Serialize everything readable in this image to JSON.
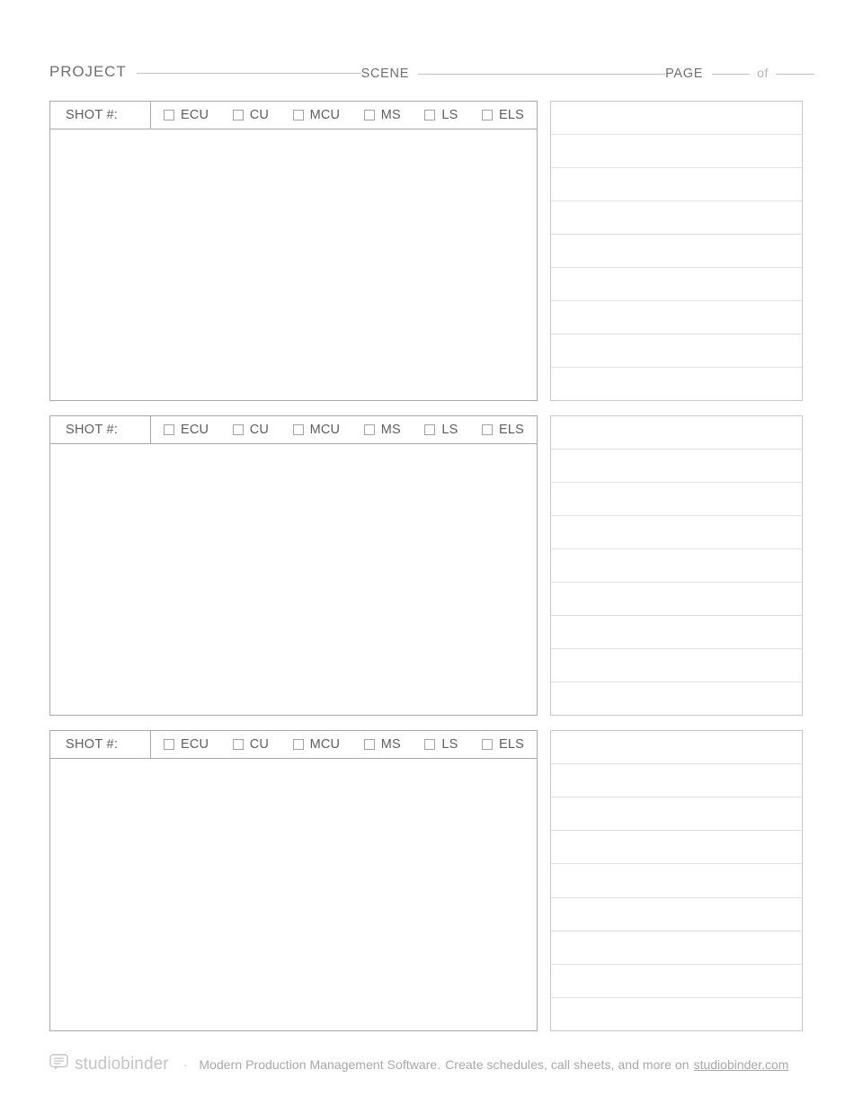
{
  "header": {
    "project_label": "PROJECT",
    "scene_label": "SCENE",
    "page_label": "PAGE",
    "of_label": "of",
    "project_value": "",
    "scene_value": "",
    "page_value": "",
    "page_total_value": ""
  },
  "shot_block": {
    "shot_number_label": "SHOT #:",
    "shot_number_value": "",
    "shot_types": [
      {
        "label": "ECU",
        "checked": false
      },
      {
        "label": "CU",
        "checked": false
      },
      {
        "label": "MCU",
        "checked": false
      },
      {
        "label": "MS",
        "checked": false
      },
      {
        "label": "LS",
        "checked": false
      },
      {
        "label": "ELS",
        "checked": false
      }
    ],
    "notes_line_count": 9,
    "notes_lines": [
      "",
      "",
      "",
      "",
      "",
      "",
      "",
      "",
      ""
    ]
  },
  "blocks": [
    {
      "shot_number_label": "SHOT #:",
      "shot_number_value": "",
      "shot_types": [
        {
          "label": "ECU",
          "checked": false
        },
        {
          "label": "CU",
          "checked": false
        },
        {
          "label": "MCU",
          "checked": false
        },
        {
          "label": "MS",
          "checked": false
        },
        {
          "label": "LS",
          "checked": false
        },
        {
          "label": "ELS",
          "checked": false
        }
      ],
      "frame_content": "",
      "notes_lines": [
        "",
        "",
        "",
        "",
        "",
        "",
        "",
        "",
        ""
      ]
    },
    {
      "shot_number_label": "SHOT #:",
      "shot_number_value": "",
      "shot_types": [
        {
          "label": "ECU",
          "checked": false
        },
        {
          "label": "CU",
          "checked": false
        },
        {
          "label": "MCU",
          "checked": false
        },
        {
          "label": "MS",
          "checked": false
        },
        {
          "label": "LS",
          "checked": false
        },
        {
          "label": "ELS",
          "checked": false
        }
      ],
      "frame_content": "",
      "notes_lines": [
        "",
        "",
        "",
        "",
        "",
        "",
        "",
        "",
        ""
      ]
    },
    {
      "shot_number_label": "SHOT #:",
      "shot_number_value": "",
      "shot_types": [
        {
          "label": "ECU",
          "checked": false
        },
        {
          "label": "CU",
          "checked": false
        },
        {
          "label": "MCU",
          "checked": false
        },
        {
          "label": "MS",
          "checked": false
        },
        {
          "label": "LS",
          "checked": false
        },
        {
          "label": "ELS",
          "checked": false
        }
      ],
      "frame_content": "",
      "notes_lines": [
        "",
        "",
        "",
        "",
        "",
        "",
        "",
        "",
        ""
      ]
    }
  ],
  "footer": {
    "logo_icon": "speech-bubble-icon",
    "logo_text": "studiobinder",
    "separator": "·",
    "tagline": "Modern Production Management Software.",
    "tagline2": "Create schedules, call sheets, and more on",
    "link_text": "studiobinder.com"
  },
  "colors": {
    "text": "#6b6b6b",
    "rule": "#c3c3c3",
    "frame_border": "#a9a9a9",
    "notes_border": "#c8c8c8",
    "notes_line": "#e2e2e2",
    "footer_text": "#a8a8a8",
    "logo": "#c4c4c4",
    "page_bg": "#ffffff"
  }
}
